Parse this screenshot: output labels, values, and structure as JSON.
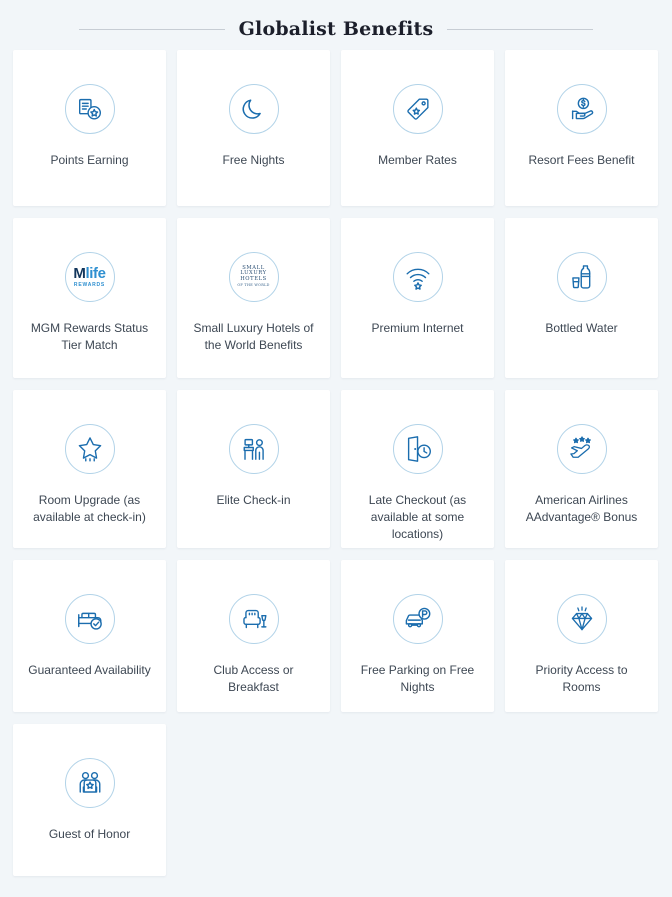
{
  "header": {
    "title": "Globalist Benefits"
  },
  "benefits": [
    [
      {
        "label": "Points Earning",
        "icon": "coins-star-icon"
      },
      {
        "label": "Free Nights",
        "icon": "moon-icon"
      },
      {
        "label": "Member Rates",
        "icon": "price-tag-star-icon"
      },
      {
        "label": "Resort Fees Benefit",
        "icon": "hand-dollar-icon"
      }
    ],
    [
      {
        "label": "MGM Rewards Status Tier Match",
        "icon": "mlife-rewards-logo-icon",
        "logo": {
          "top_m": "M",
          "top_rest": "life",
          "bottom": "REWARDS"
        }
      },
      {
        "label": "Small Luxury Hotels of the World Benefits",
        "icon": "small-luxury-hotels-logo-icon",
        "logo": {
          "line1": "SMALL",
          "line2": "LUXURY",
          "line3": "HOTELS",
          "line4": "OF THE WORLD"
        }
      },
      {
        "label": "Premium Internet",
        "icon": "wifi-star-icon"
      },
      {
        "label": "Bottled Water",
        "icon": "water-bottle-icon"
      }
    ],
    [
      {
        "label": "Room Upgrade (as available at check-in)",
        "icon": "rising-star-icon"
      },
      {
        "label": "Elite Check-in",
        "icon": "reception-desk-icon"
      },
      {
        "label": "Late Checkout (as available at some locations)",
        "icon": "door-clock-icon"
      },
      {
        "label": "American Airlines AAdvantage® Bonus",
        "icon": "airplane-stars-icon"
      }
    ],
    [
      {
        "label": "Guaranteed Availability",
        "icon": "bed-check-icon"
      },
      {
        "label": "Club Access or Breakfast",
        "icon": "armchair-drink-icon"
      },
      {
        "label": "Free Parking on Free Nights",
        "icon": "car-parking-icon"
      },
      {
        "label": "Priority Access to Rooms",
        "icon": "diamond-icon"
      }
    ],
    [
      {
        "label": "Guest of Honor",
        "icon": "two-people-star-icon"
      }
    ]
  ],
  "colors": {
    "background": "#f2f6f9",
    "card": "#ffffff",
    "icon_stroke": "#1b6dae",
    "icon_circle_border": "#b2d3e8",
    "label_text": "#3d4753",
    "title_text": "#1c1f2b",
    "rule": "#c7cdd4"
  }
}
